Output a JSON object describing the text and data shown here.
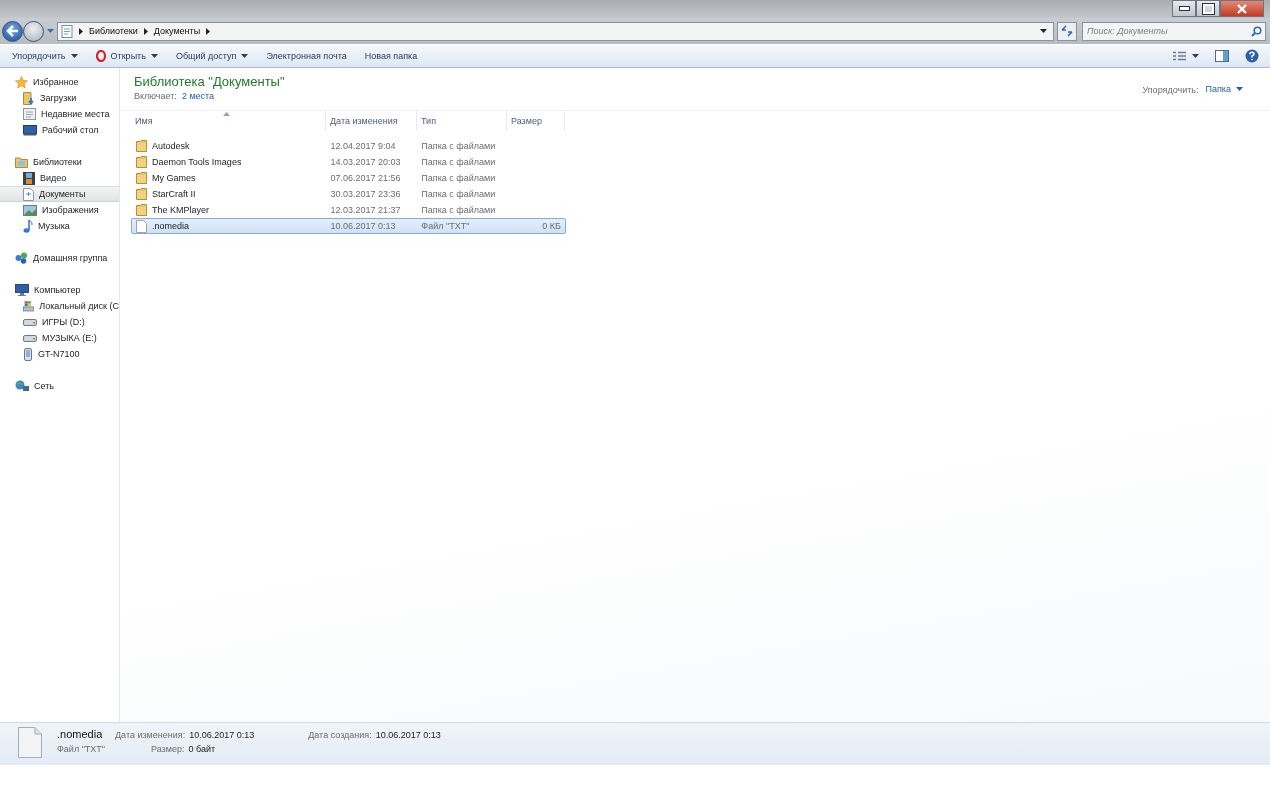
{
  "address_bar": {
    "path": [
      "Библиотеки",
      "Документы"
    ]
  },
  "search": {
    "placeholder": "Поиск: Документы"
  },
  "toolbar": {
    "items": [
      {
        "label": "Упорядочить",
        "kind": "menu"
      },
      {
        "label": "Открыть",
        "kind": "open"
      },
      {
        "label": "Общий доступ",
        "kind": "menu"
      },
      {
        "label": "Электронная почта",
        "kind": "plain"
      },
      {
        "label": "Новая папка",
        "kind": "plain"
      }
    ]
  },
  "sidebar": {
    "groups": [
      {
        "label": "Избранное",
        "kind": "star",
        "children": [
          {
            "label": "Загрузки",
            "kind": "downloads",
            "selected": false
          },
          {
            "label": "Недавние места",
            "kind": "recent",
            "selected": false
          },
          {
            "label": "Рабочий стол",
            "kind": "desktop",
            "selected": false
          }
        ]
      },
      {
        "label": "Библиотеки",
        "kind": "library",
        "children": [
          {
            "label": "Видео",
            "kind": "video",
            "selected": false
          },
          {
            "label": "Документы",
            "kind": "document",
            "selected": true
          },
          {
            "label": "Изображения",
            "kind": "image",
            "selected": false
          },
          {
            "label": "Музыка",
            "kind": "music",
            "selected": false
          }
        ]
      },
      {
        "label": "Домашняя группа",
        "kind": "homegroup"
      },
      {
        "label": "Компьютер",
        "kind": "computer",
        "children": [
          {
            "label": "Локальный диск (C",
            "kind": "system-drive",
            "selected": false
          },
          {
            "label": "ИГРЫ (D:)",
            "kind": "drive",
            "selected": false
          },
          {
            "label": "МУЗЫКА (E:)",
            "kind": "drive",
            "selected": false
          },
          {
            "label": "GT-N7100",
            "kind": "phone",
            "selected": false
          }
        ]
      },
      {
        "label": "Сеть",
        "kind": "network"
      }
    ]
  },
  "library": {
    "title": "Библиотека \"Документы\"",
    "includes_label": "Включает:",
    "includes_link": "2 места",
    "arrange_label": "Упорядочить:",
    "arrange_value": "Папка"
  },
  "table": {
    "columns": [
      "Имя",
      "Дата изменения",
      "Тип",
      "Размер"
    ],
    "rows": [
      {
        "kind": "folder",
        "name": "Autodesk",
        "date": "12.04.2017 9:04",
        "type": "Папка с файлами",
        "selected": false
      },
      {
        "kind": "folder",
        "name": "Daemon Tools Images",
        "date": "14.03.2017 20:03",
        "type": "Папка с файлами",
        "selected": false
      },
      {
        "kind": "folder",
        "name": "My Games",
        "date": "07.06.2017 21:56",
        "type": "Папка с файлами",
        "selected": false
      },
      {
        "kind": "folder",
        "name": "StarCraft II",
        "date": "30.03.2017 23:36",
        "type": "Папка с файлами",
        "selected": false
      },
      {
        "kind": "folder",
        "name": "The KMPlayer",
        "date": "12.03.2017 21:37",
        "type": "Папка с файлами",
        "selected": false
      },
      {
        "kind": "file",
        "name": ".nomedia",
        "date": "10.06.2017 0:13",
        "type": "Файл \"TXT\"",
        "size": "0 КБ",
        "selected": true
      }
    ]
  },
  "details": {
    "name": ".nomedia",
    "type": "Файл \"TXT\"",
    "modified_label": "Дата изменения:",
    "modified": "10.06.2017 0:13",
    "size_label": "Размер:",
    "size": "0 байт",
    "created_label": "Дата создания:",
    "created": "10.06.2017 0:13"
  }
}
